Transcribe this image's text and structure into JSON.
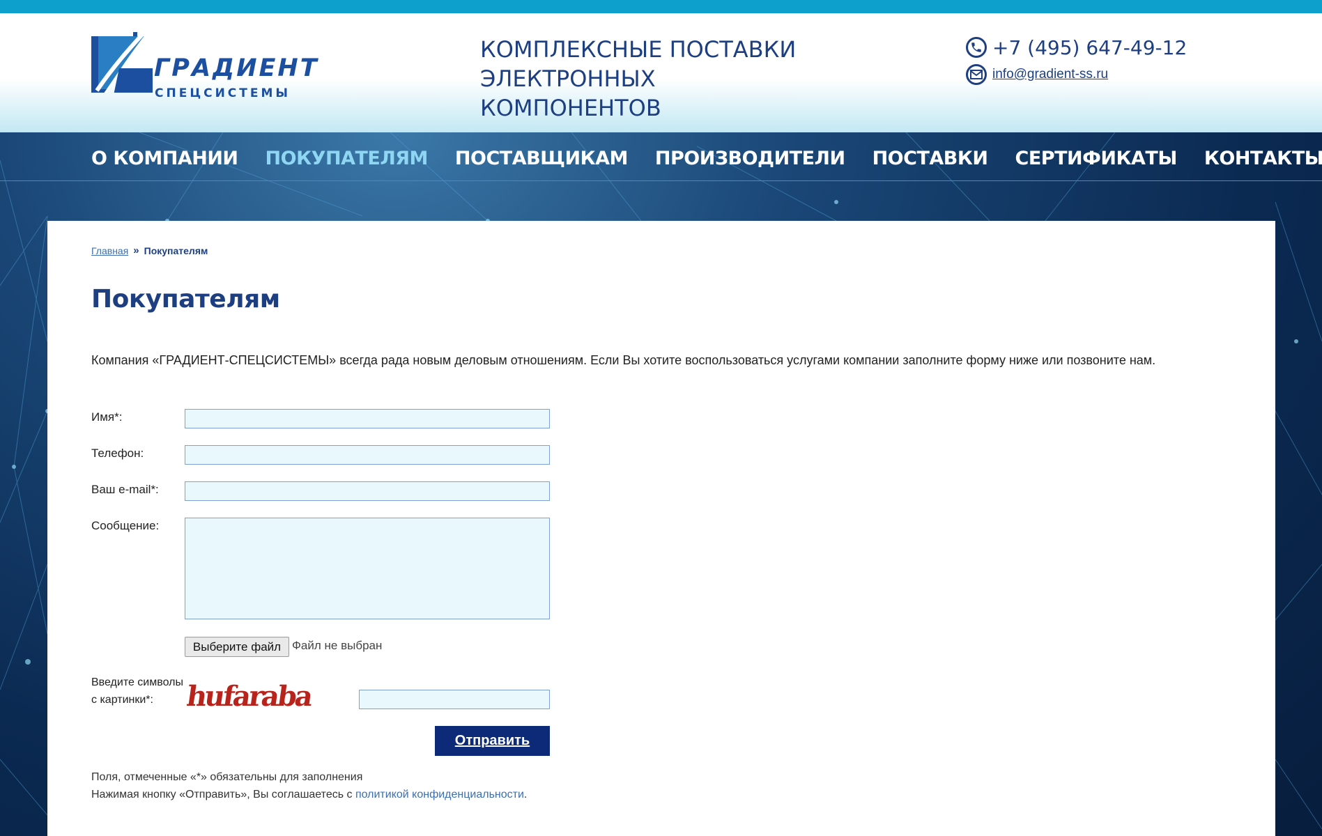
{
  "logo": {
    "title": "ГРАДИЕНТ",
    "subtitle": "СПЕЦСИСТЕМЫ"
  },
  "header": {
    "tagline_line1": "КОМПЛЕКСНЫЕ ПОСТАВКИ",
    "tagline_line2": "ЭЛЕКТРОННЫХ КОМПОНЕНТОВ",
    "phone": "+7 (495) 647-49-12",
    "email": "info@gradient-ss.ru"
  },
  "nav": {
    "items": [
      {
        "label": "О КОМПАНИИ"
      },
      {
        "label": "ПОКУПАТЕЛЯМ"
      },
      {
        "label": "ПОСТАВЩИКАМ"
      },
      {
        "label": "ПРОИЗВОДИТЕЛИ"
      },
      {
        "label": "ПОСТАВКИ"
      },
      {
        "label": "СЕРТИФИКАТЫ"
      },
      {
        "label": "КОНТАКТЫ"
      }
    ],
    "active": "ПОКУПАТЕЛЯМ"
  },
  "breadcrumb": {
    "home": "Главная",
    "separator": "»",
    "current": "Покупателям"
  },
  "page_title": "Покупателям",
  "intro": "Компания «ГРАДИЕНТ-СПЕЦСИСТЕМЫ» всегда рада новым деловым отношениям. Если Вы хотите воспользоваться услугами компании заполните форму ниже или позвоните нам.",
  "form": {
    "name_label": "Имя*:",
    "name_value": "",
    "phone_label": "Телефон:",
    "phone_value": "",
    "email_label": "Ваш e-mail*:",
    "email_value": "",
    "message_label": "Сообщение:",
    "message_value": "",
    "file_button": "Выберите файл",
    "file_status": "Файл не выбран",
    "captcha_label_line1": "Введите символы",
    "captcha_label_line2": "с картинки*:",
    "captcha_text": "hufaraba",
    "captcha_value": "",
    "submit": "Отправить"
  },
  "notes": {
    "required": "Поля, отмеченные «*» обязательны для заполнения",
    "consent_prefix": "Нажимая кнопку «Отправить», Вы соглашаетесь с ",
    "consent_link": "политикой конфиденциальности",
    "consent_suffix": "."
  },
  "colors": {
    "brand_blue": "#1d3f82",
    "accent_cyan": "#0ea0cc",
    "nav_active": "#8fd6f2",
    "submit_bg": "#0d2a78",
    "input_bg": "#e8f8fc"
  }
}
